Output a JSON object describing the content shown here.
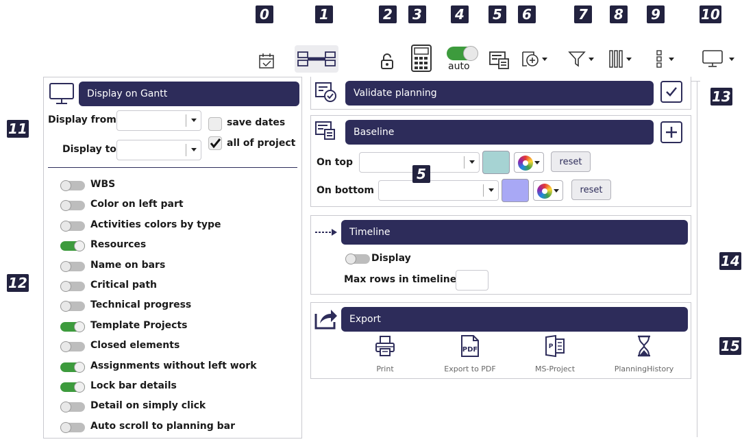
{
  "markers": [
    "0",
    "1",
    "2",
    "3",
    "4",
    "5",
    "6",
    "7",
    "8",
    "9",
    "10",
    "11",
    "12",
    "13",
    "14",
    "15",
    "5"
  ],
  "toolbar": {
    "auto_label": "auto"
  },
  "display_gantt": {
    "title": "Display on Gantt",
    "display_from_label": "Display from",
    "display_to_label": "Display to",
    "save_dates_label": "save dates",
    "all_of_project_label": "all of project",
    "all_of_project_checked": true,
    "save_dates_checked": false,
    "toggles": [
      {
        "label": "WBS",
        "on": false
      },
      {
        "label": "Color on left part",
        "on": false
      },
      {
        "label": "Activities colors by type",
        "on": false
      },
      {
        "label": "Resources",
        "on": true
      },
      {
        "label": "Name on bars",
        "on": false
      },
      {
        "label": "Critical path",
        "on": false
      },
      {
        "label": "Technical progress",
        "on": false
      },
      {
        "label": "Template Projects",
        "on": true
      },
      {
        "label": "Closed elements",
        "on": false
      },
      {
        "label": "Assignments without left work",
        "on": true
      },
      {
        "label": "Lock bar details",
        "on": true
      },
      {
        "label": "Detail on simply click",
        "on": false
      },
      {
        "label": "Auto scroll to planning bar",
        "on": false
      }
    ]
  },
  "validate": {
    "title": "Validate planning"
  },
  "baseline": {
    "title": "Baseline",
    "on_top_label": "On top",
    "on_bottom_label": "On bottom",
    "reset_label": "reset",
    "top_color": "#a6d3d3",
    "bottom_color": "#a8a8f5"
  },
  "timeline": {
    "title": "Timeline",
    "display_label": "Display",
    "max_rows_label": "Max rows in timeline"
  },
  "export": {
    "title": "Export",
    "items": [
      "Print",
      "Export to PDF",
      "MS-Project",
      "PlanningHistory"
    ]
  },
  "colors": {
    "header_bg": "#2d2c5a",
    "toggle_on": "#3d9b3d",
    "toggle_off": "#bdbdbd"
  }
}
